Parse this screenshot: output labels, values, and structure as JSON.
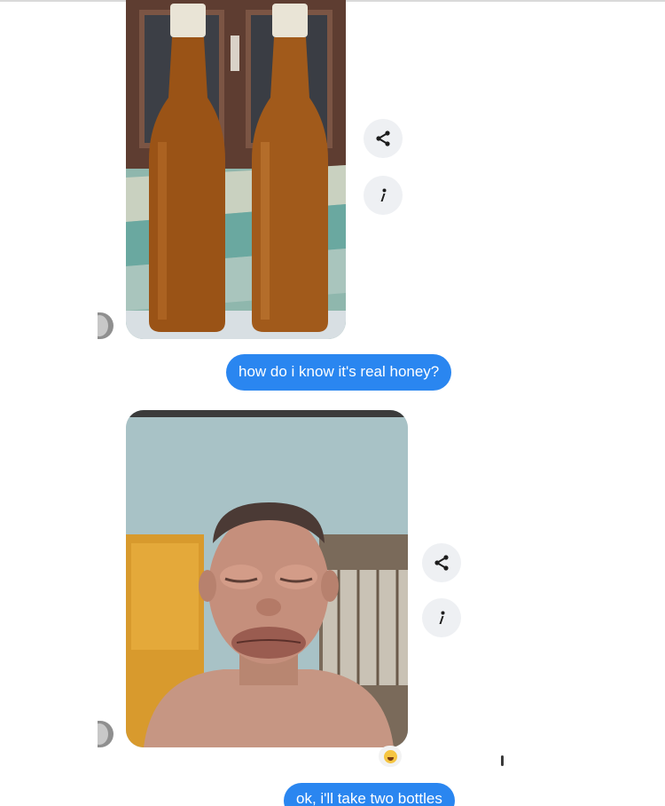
{
  "conversation": {
    "messages": [
      {
        "type": "image",
        "sender": "seller",
        "image_name": "honey-bottles-photo",
        "description_icon": "photo"
      },
      {
        "type": "text",
        "sender": "me",
        "text": "how do i know it's real honey?"
      },
      {
        "type": "image",
        "sender": "seller",
        "image_name": "swollen-face-photo",
        "description_icon": "photo"
      },
      {
        "type": "text",
        "sender": "me",
        "text": "ok, i'll take two bottles"
      }
    ]
  },
  "actions": {
    "share_icon": "share-icon",
    "info_icon": "info-icon"
  },
  "reaction": {
    "icon": "laugh-cry-emoji-icon"
  },
  "colors": {
    "bubble_blue": "#2a86f0",
    "button_bg": "#eef0f3",
    "background": "#ffffff"
  }
}
